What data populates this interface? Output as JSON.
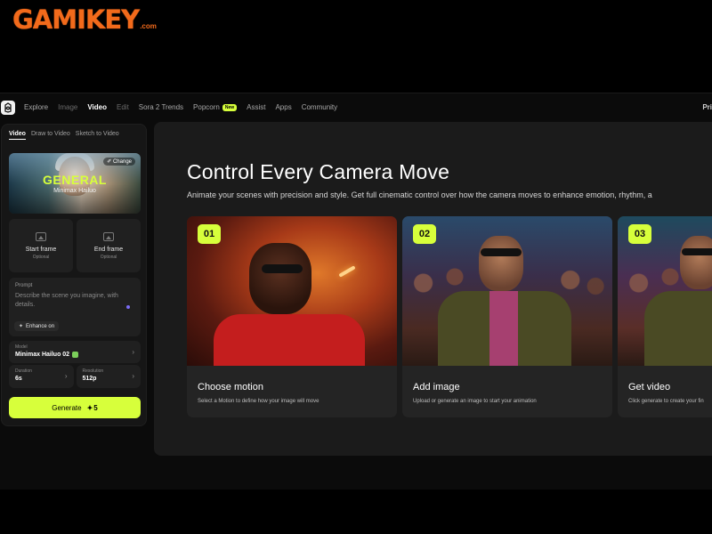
{
  "watermark": {
    "main": "GAMIKEY",
    "suffix": ".com"
  },
  "nav": {
    "items": [
      {
        "label": "Explore",
        "state": "normal"
      },
      {
        "label": "Image",
        "state": "dim"
      },
      {
        "label": "Video",
        "state": "active"
      },
      {
        "label": "Edit",
        "state": "dim"
      },
      {
        "label": "Sora 2 Trends",
        "state": "normal"
      },
      {
        "label": "Popcorn",
        "state": "normal",
        "badge": "New"
      },
      {
        "label": "Assist",
        "state": "normal"
      },
      {
        "label": "Apps",
        "state": "normal"
      },
      {
        "label": "Community",
        "state": "normal"
      }
    ],
    "right_text": "Pri"
  },
  "panel": {
    "tabs": [
      "Video",
      "Draw to Video",
      "Sketch to Video"
    ],
    "active_tab": "Video",
    "preset": {
      "title": "GENERAL",
      "subtitle": "Minimax Hailuo",
      "change_label": "✐ Change"
    },
    "start_frame": {
      "label": "Start frame",
      "sub": "Optional"
    },
    "end_frame": {
      "label": "End frame",
      "sub": "Optional"
    },
    "prompt": {
      "label": "Prompt",
      "placeholder": "Describe the scene you imagine, with details.",
      "enhance_label": "Enhance on"
    },
    "model": {
      "label": "Model",
      "value": "Minimax Hailuo 02"
    },
    "duration": {
      "label": "Duration",
      "value": "6s"
    },
    "resolution": {
      "label": "Resolution",
      "value": "512p"
    },
    "generate": {
      "label": "Generate",
      "credits": "5"
    }
  },
  "main": {
    "title": "Control Every Camera Move",
    "subtitle": "Animate your scenes with precision and style. Get full cinematic control over how the camera moves to enhance emotion, rhythm, a",
    "cards": [
      {
        "number": "01",
        "title": "Choose motion",
        "desc": "Select a Motion to define how your image will move"
      },
      {
        "number": "02",
        "title": "Add image",
        "desc": "Upload or generate an image to start your animation"
      },
      {
        "number": "03",
        "title": "Get video",
        "desc": "Click generate to create your fin"
      }
    ]
  },
  "colors": {
    "accent": "#d7ff3b",
    "watermark": "#f26a1b",
    "background": "#000000",
    "panel": "#161616",
    "card": "#242424"
  },
  "icons": [
    "app-logo-icon",
    "edit-icon",
    "image-upload-icon",
    "sparkle-icon",
    "chevron-right-icon",
    "credit-icon"
  ]
}
